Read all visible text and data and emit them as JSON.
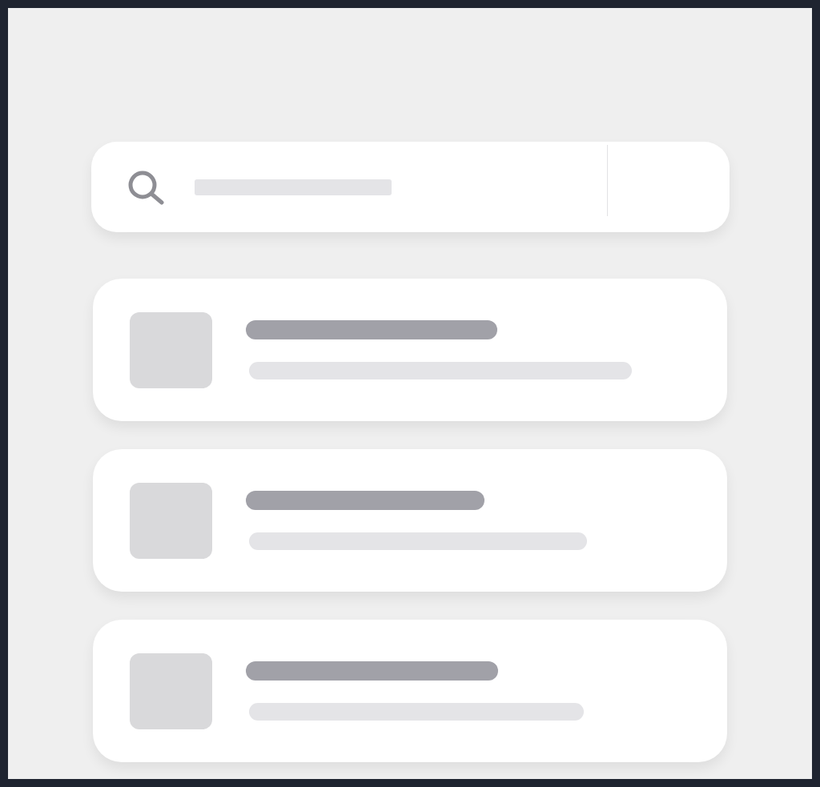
{
  "search": {
    "kind": "skeleton"
  },
  "results": [
    {
      "kind": "skeleton"
    },
    {
      "kind": "skeleton"
    },
    {
      "kind": "skeleton"
    }
  ]
}
